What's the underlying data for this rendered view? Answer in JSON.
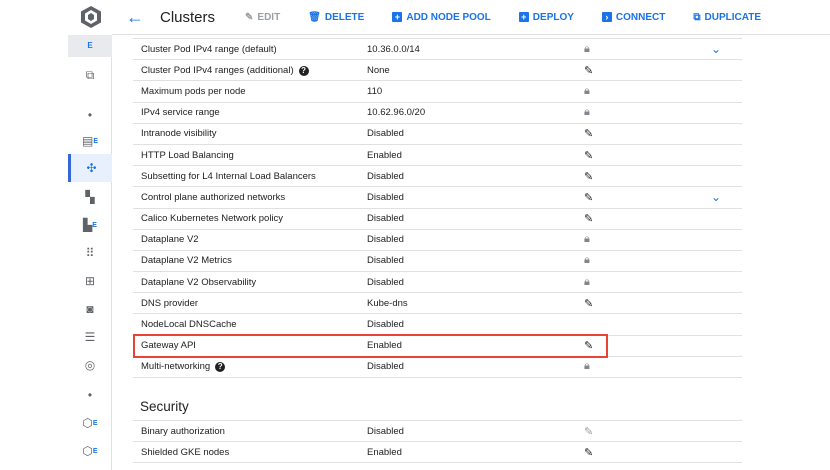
{
  "header": {
    "title": "Clusters",
    "buttons": [
      {
        "label": "EDIT",
        "icon": "edit-icon",
        "enabled": false
      },
      {
        "label": "DELETE",
        "icon": "trash-icon",
        "enabled": true
      },
      {
        "label": "ADD NODE POOL",
        "icon": "add-box-icon",
        "enabled": true
      },
      {
        "label": "DEPLOY",
        "icon": "add-box-icon",
        "enabled": true
      },
      {
        "label": "CONNECT",
        "icon": "terminal-icon",
        "enabled": true
      },
      {
        "label": "DUPLICATE",
        "icon": "copy-icon",
        "enabled": true
      }
    ]
  },
  "rail": {
    "badge": "E",
    "item_badge": "E"
  },
  "networking": [
    {
      "label": "Cluster Pod IPv4 range (default)",
      "value": "10.36.0.0/14",
      "action": "lock",
      "chevron": true
    },
    {
      "label": "Cluster Pod IPv4 ranges (additional)",
      "value": "None",
      "action": "edit",
      "help": true
    },
    {
      "label": "Maximum pods per node",
      "value": "110",
      "action": "lock"
    },
    {
      "label": "IPv4 service range",
      "value": "10.62.96.0/20",
      "action": "lock"
    },
    {
      "label": "Intranode visibility",
      "value": "Disabled",
      "action": "edit"
    },
    {
      "label": "HTTP Load Balancing",
      "value": "Enabled",
      "action": "edit"
    },
    {
      "label": "Subsetting for L4 Internal Load Balancers",
      "value": "Disabled",
      "action": "edit"
    },
    {
      "label": "Control plane authorized networks",
      "value": "Disabled",
      "action": "edit",
      "chevron": true
    },
    {
      "label": "Calico Kubernetes Network policy",
      "value": "Disabled",
      "action": "edit"
    },
    {
      "label": "Dataplane V2",
      "value": "Disabled",
      "action": "lock"
    },
    {
      "label": "Dataplane V2 Metrics",
      "value": "Disabled",
      "action": "lock"
    },
    {
      "label": "Dataplane V2 Observability",
      "value": "Disabled",
      "action": "lock"
    },
    {
      "label": "DNS provider",
      "value": "Kube-dns",
      "action": "edit"
    },
    {
      "label": "NodeLocal DNSCache",
      "value": "Disabled",
      "action": "none"
    },
    {
      "label": "Gateway API",
      "value": "Enabled",
      "action": "edit"
    },
    {
      "label": "Multi-networking",
      "value": "Disabled",
      "action": "lock",
      "help": true
    }
  ],
  "security": {
    "title": "Security",
    "rows": [
      {
        "label": "Binary authorization",
        "value": "Disabled",
        "action": "edit-disabled"
      },
      {
        "label": "Shielded GKE nodes",
        "value": "Enabled",
        "action": "edit"
      }
    ]
  },
  "help_glyph": "?"
}
